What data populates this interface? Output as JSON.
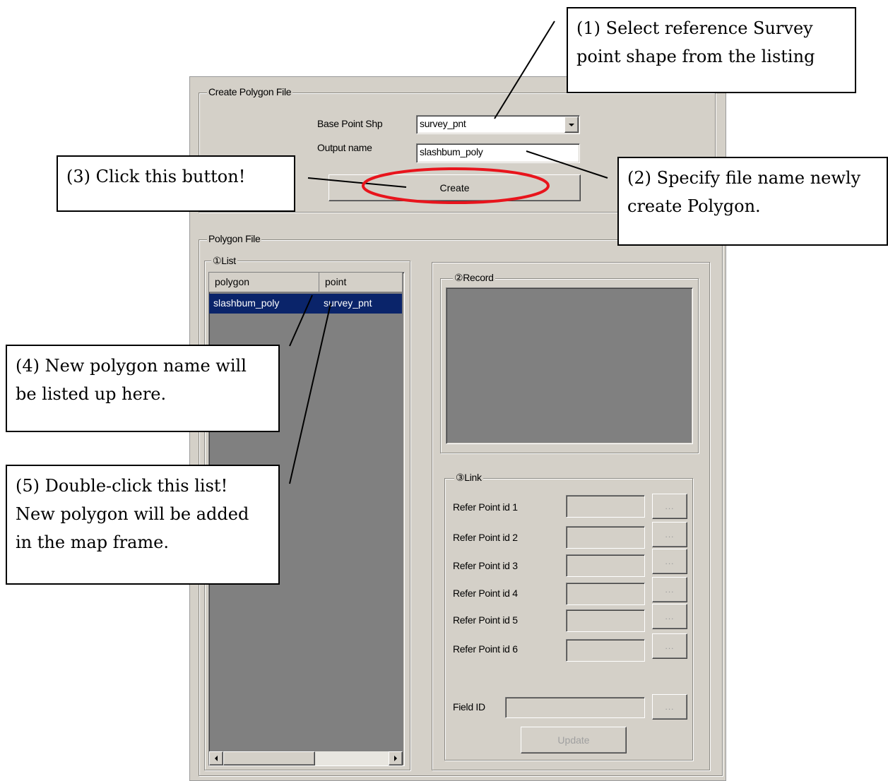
{
  "dialog": {
    "create_group": {
      "title": "Create Polygon File",
      "base_point_label": "Base Point Shp",
      "base_point_value": "survey_pnt",
      "output_name_label": "Output name",
      "output_name_value": "slashbum_poly",
      "create_button": "Create"
    },
    "polygon_group": {
      "title": "Polygon File",
      "list": {
        "title": "①List",
        "columns": [
          "polygon",
          "point"
        ],
        "rows": [
          [
            "slashbum_poly",
            "survey_pnt"
          ]
        ]
      },
      "record": {
        "title": "②Record"
      },
      "link": {
        "title": "③Link",
        "refer_labels": [
          "Refer Point id 1",
          "Refer Point id 2",
          "Refer Point id 3",
          "Refer Point id 4",
          "Refer Point id 5",
          "Refer Point id 6"
        ],
        "browse_label": "...",
        "field_id_label": "Field ID",
        "update_button": "Update"
      }
    }
  },
  "callouts": {
    "c1": [
      "(1)  Select  reference  Survey",
      "point shape from the listing"
    ],
    "c2": [
      "(2) Specify file name newly",
      "create Polygon."
    ],
    "c3": [
      "(3) Click this button!"
    ],
    "c4": [
      "(4) New polygon name will",
      "be listed up here."
    ],
    "c5": [
      "(5) Double-click this list!",
      "New polygon will be added",
      "in the map frame."
    ]
  },
  "colors": {
    "dialog_bg": "#d4d0c8",
    "selection": "#0a246a",
    "highlight_ellipse": "#e8141c",
    "list_bg": "#808080"
  }
}
